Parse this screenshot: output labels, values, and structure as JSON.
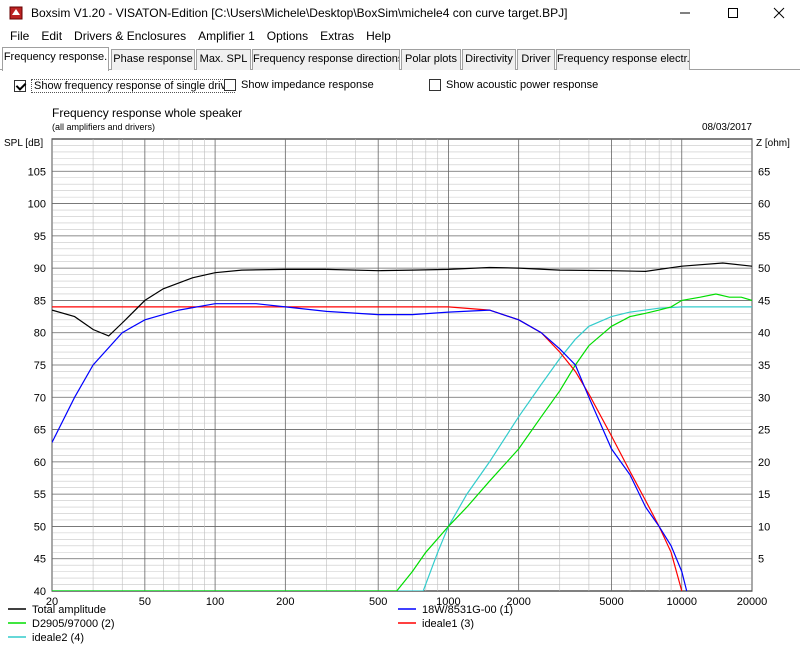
{
  "window": {
    "title": "Boxsim V1.20 - VISATON-Edition [C:\\Users\\Michele\\Desktop\\BoxSim\\michele4 con curve target.BPJ]",
    "icon": "boxsim-app-icon",
    "controls": [
      "minimize-icon",
      "maximize-icon",
      "close-icon"
    ]
  },
  "menu": [
    "File",
    "Edit",
    "Drivers & Enclosures",
    "Amplifier 1",
    "Options",
    "Extras",
    "Help"
  ],
  "tabs": [
    {
      "label": "Frequency response.",
      "active": true
    },
    {
      "label": "Phase response",
      "active": false
    },
    {
      "label": "Max. SPL",
      "active": false
    },
    {
      "label": "Frequency response directions",
      "active": false
    },
    {
      "label": "Polar plots",
      "active": false
    },
    {
      "label": "Directivity",
      "active": false
    },
    {
      "label": "Driver",
      "active": false
    },
    {
      "label": "Frequency response electr..",
      "active": false
    }
  ],
  "options": [
    {
      "label": "Show frequency response of single drive",
      "checked": true
    },
    {
      "label": "Show impedance response",
      "checked": false
    },
    {
      "label": "Show acoustic power response",
      "checked": false
    }
  ],
  "chart_data": {
    "type": "line",
    "title": "Frequency response whole speaker",
    "subtitle": "(all amplifiers and drivers)",
    "date": "08/03/2017",
    "ylabel": "SPL [dB]",
    "y2label": "Z [ohm]",
    "xscale": "log",
    "xlim": [
      20,
      20000
    ],
    "ylim": [
      40,
      110
    ],
    "y2lim": [
      0,
      70
    ],
    "xticks": [
      20,
      50,
      100,
      200,
      500,
      1000,
      2000,
      5000,
      10000,
      20000
    ],
    "yticks": [
      40,
      45,
      50,
      55,
      60,
      65,
      70,
      75,
      80,
      85,
      90,
      95,
      100,
      105
    ],
    "y2ticks": [
      5,
      10,
      15,
      20,
      25,
      30,
      35,
      40,
      45,
      50,
      55,
      60,
      65
    ],
    "grid": true,
    "legend_position": "bottom",
    "series": [
      {
        "name": "Total amplitude",
        "color": "#000000",
        "x": [
          20,
          25,
          30,
          35,
          40,
          50,
          60,
          80,
          100,
          130,
          200,
          300,
          500,
          700,
          1000,
          1500,
          2000,
          3000,
          5000,
          7000,
          10000,
          15000,
          20000
        ],
        "y": [
          83.5,
          82.5,
          80.5,
          79.5,
          81.5,
          85,
          86.8,
          88.5,
          89.3,
          89.7,
          89.8,
          89.8,
          89.6,
          89.7,
          89.8,
          90.1,
          90,
          89.7,
          89.6,
          89.5,
          90.3,
          90.8,
          90.3
        ]
      },
      {
        "name": "18W/8531G-00 (1)",
        "color": "#0000ff",
        "x": [
          20,
          25,
          30,
          40,
          50,
          70,
          100,
          150,
          200,
          300,
          500,
          700,
          1000,
          1500,
          2000,
          2500,
          3000,
          3500,
          4000,
          5000,
          6000,
          7000,
          8000,
          9000,
          10000,
          10500
        ],
        "y": [
          63,
          70,
          75,
          80,
          82,
          83.5,
          84.5,
          84.5,
          84,
          83.3,
          82.8,
          82.8,
          83.2,
          83.5,
          82,
          80,
          77.5,
          75,
          70,
          62,
          58,
          53,
          50,
          47,
          43,
          40
        ]
      },
      {
        "name": "ideale1 (3)",
        "color": "#ff0000",
        "x": [
          20,
          200,
          1000,
          1500,
          2000,
          2500,
          3000,
          3500,
          4000,
          5000,
          6000,
          7000,
          8000,
          9000,
          10000
        ],
        "y": [
          84,
          84,
          84,
          83.5,
          82,
          80,
          77,
          74,
          70.5,
          64,
          58.5,
          54,
          50,
          46,
          40
        ]
      },
      {
        "name": "D2905/97000 (2)",
        "color": "#00dd00",
        "x": [
          20,
          600,
          700,
          800,
          1000,
          1200,
          1500,
          2000,
          2500,
          3000,
          3500,
          4000,
          5000,
          6000,
          7000,
          8000,
          9000,
          10000,
          12000,
          14000,
          16000,
          18000,
          20000
        ],
        "y": [
          40,
          40,
          43,
          46,
          50,
          53,
          57,
          62,
          67,
          71,
          75,
          78,
          81,
          82.5,
          83,
          83.5,
          84,
          85,
          85.5,
          86,
          85.5,
          85.5,
          85
        ]
      },
      {
        "name": "ideale2 (4)",
        "color": "#33cccc",
        "x": [
          20,
          780,
          900,
          1000,
          1200,
          1500,
          2000,
          2500,
          3000,
          3500,
          4000,
          5000,
          6000,
          8000,
          10000,
          20000
        ],
        "y": [
          40,
          40,
          46,
          50,
          55,
          60,
          67,
          72,
          76,
          79,
          81,
          82.5,
          83.2,
          83.8,
          84,
          84
        ]
      }
    ]
  }
}
